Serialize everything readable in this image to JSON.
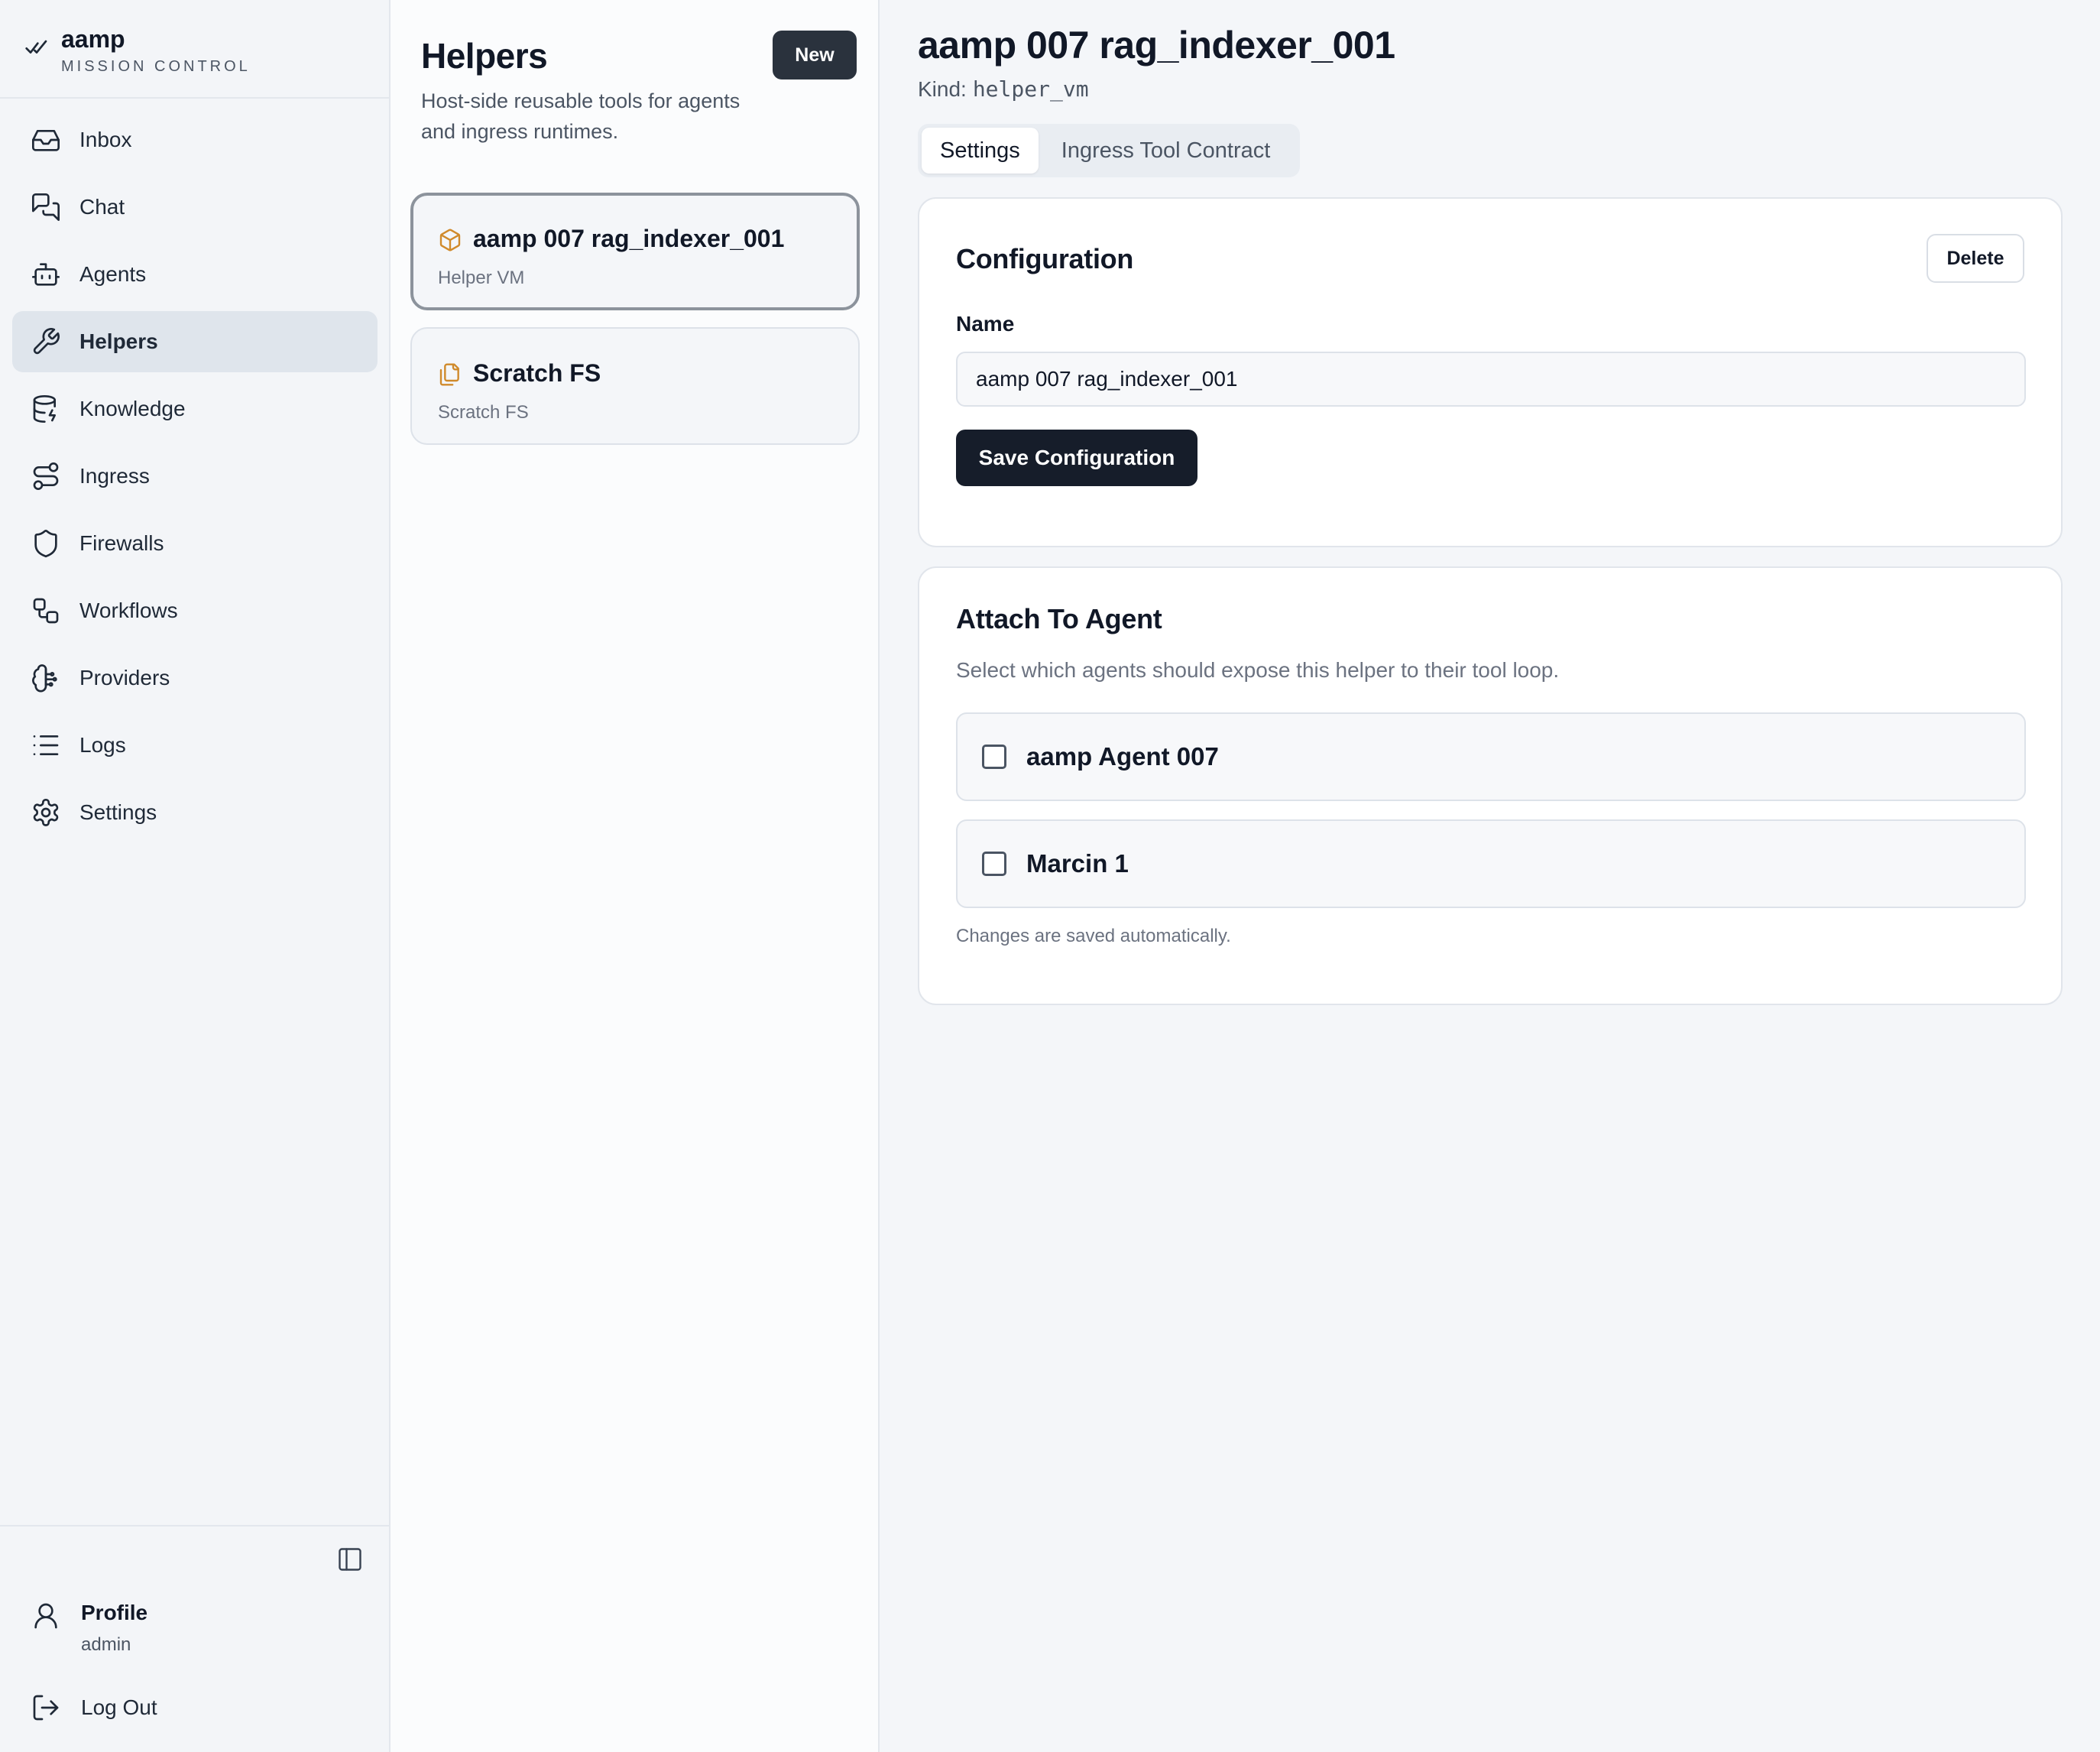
{
  "brand": {
    "name": "aamp",
    "subtitle": "MISSION CONTROL"
  },
  "nav": {
    "items": [
      {
        "label": "Inbox",
        "icon": "inbox-icon",
        "active": false
      },
      {
        "label": "Chat",
        "icon": "chat-icon",
        "active": false
      },
      {
        "label": "Agents",
        "icon": "bot-icon",
        "active": false
      },
      {
        "label": "Helpers",
        "icon": "wrench-icon",
        "active": true
      },
      {
        "label": "Knowledge",
        "icon": "database-icon",
        "active": false
      },
      {
        "label": "Ingress",
        "icon": "route-icon",
        "active": false
      },
      {
        "label": "Firewalls",
        "icon": "shield-icon",
        "active": false
      },
      {
        "label": "Workflows",
        "icon": "workflow-icon",
        "active": false
      },
      {
        "label": "Providers",
        "icon": "brain-icon",
        "active": false
      },
      {
        "label": "Logs",
        "icon": "list-icon",
        "active": false
      },
      {
        "label": "Settings",
        "icon": "gear-icon",
        "active": false
      }
    ]
  },
  "sidebar_footer": {
    "profile_title": "Profile",
    "profile_user": "admin",
    "logout_label": "Log Out"
  },
  "helpers_panel": {
    "title": "Helpers",
    "description": "Host-side reusable tools for agents and ingress runtimes.",
    "new_label": "New",
    "items": [
      {
        "title": "aamp 007 rag_indexer_001",
        "subtitle": "Helper VM",
        "icon": "box-icon",
        "selected": true
      },
      {
        "title": "Scratch FS",
        "subtitle": "Scratch FS",
        "icon": "files-icon",
        "selected": false
      }
    ]
  },
  "detail": {
    "title": "aamp 007 rag_indexer_001",
    "kind_label": "Kind:",
    "kind_value": "helper_vm",
    "tabs": [
      {
        "label": "Settings",
        "active": true
      },
      {
        "label": "Ingress Tool Contract",
        "active": false
      }
    ],
    "configuration": {
      "title": "Configuration",
      "delete_label": "Delete",
      "name_label": "Name",
      "name_value": "aamp 007 rag_indexer_001",
      "save_label": "Save Configuration"
    },
    "attach": {
      "title": "Attach To Agent",
      "description": "Select which agents should expose this helper to their tool loop.",
      "agents": [
        {
          "name": "aamp Agent 007",
          "checked": false
        },
        {
          "name": "Marcin 1",
          "checked": false
        }
      ],
      "note": "Changes are saved automatically."
    }
  },
  "colors": {
    "accent_dark": "#161d2a",
    "helper_icon": "#d08a2b",
    "active_nav_bg": "#dfe5ec"
  }
}
